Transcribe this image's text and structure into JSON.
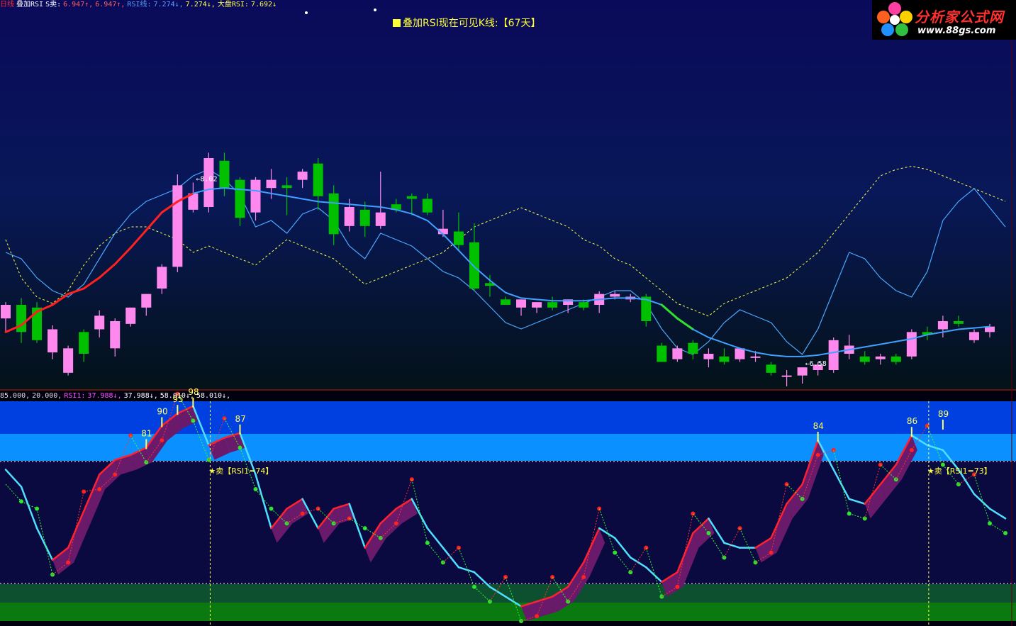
{
  "header": {
    "period": "日线",
    "indicator": "叠加RSI",
    "items": [
      {
        "label": "S卖:",
        "color": "#ffffff"
      },
      {
        "label": "6.947↑,",
        "color": "#ff6060"
      },
      {
        "label": "6.947↑,",
        "color": "#ff6060"
      },
      {
        "label": "RSI线:",
        "color": "#5aa0ff"
      },
      {
        "label": "7.274↓,",
        "color": "#5aa0ff"
      },
      {
        "label": "7.274↓,",
        "color": "#ffff55"
      },
      {
        "label": "大盘RSI:",
        "color": "#ffff55"
      },
      {
        "label": "7.692↓",
        "color": "#ffff55"
      }
    ]
  },
  "visible_bars_label": "叠加RSI现在可见K线:【67天】",
  "logo": {
    "title": "分析家公式网",
    "url": "www.88gs.com"
  },
  "sub_header": {
    "items": [
      {
        "label": "85.000,",
        "color": "#dddddd"
      },
      {
        "label": "20.000,",
        "color": "#dddddd"
      },
      {
        "label": "RSI1:",
        "color": "#ff50ff"
      },
      {
        "label": "37.988↓,",
        "color": "#ff50ff"
      },
      {
        "label": "37.988↓,",
        "color": "#ffffff"
      },
      {
        "label": "58.010↓,",
        "color": "#ffffff"
      },
      {
        "label": "58.010↓,",
        "color": "#ffffff"
      }
    ]
  },
  "colors": {
    "up_candle": "#ff88ee",
    "down_candle": "#00c000",
    "ma_line": "#3fa0ff",
    "ma_up": "#ff2020",
    "ma_down": "#30e030",
    "rsi_line": "#4aa8ff",
    "market_rsi": "#ffff44",
    "sub_rsi": "#50e0ff",
    "sub_shadow": "#6a1a6a"
  },
  "chart_data": [
    {
      "type": "candlestick",
      "title": "",
      "annotations": [
        {
          "label": "←8.02",
          "bar": 12
        },
        {
          "label": "←6.58",
          "bar": 51
        }
      ],
      "ohlc": [
        [
          6.8,
          6.92,
          6.7,
          6.9
        ],
        [
          6.9,
          6.95,
          6.62,
          6.7
        ],
        [
          6.88,
          6.92,
          6.62,
          6.64
        ],
        [
          6.55,
          6.75,
          6.5,
          6.72
        ],
        [
          6.4,
          6.6,
          6.38,
          6.58
        ],
        [
          6.7,
          6.72,
          6.48,
          6.54
        ],
        [
          6.72,
          6.86,
          6.66,
          6.82
        ],
        [
          6.58,
          6.8,
          6.52,
          6.78
        ],
        [
          6.76,
          6.88,
          6.74,
          6.88
        ],
        [
          6.88,
          6.98,
          6.82,
          6.98
        ],
        [
          7.02,
          7.2,
          6.98,
          7.18
        ],
        [
          7.18,
          7.86,
          7.14,
          7.78
        ],
        [
          7.6,
          7.8,
          7.58,
          7.72
        ],
        [
          7.62,
          8.02,
          7.58,
          7.98
        ],
        [
          7.96,
          8.02,
          7.7,
          7.76
        ],
        [
          7.82,
          7.84,
          7.48,
          7.54
        ],
        [
          7.58,
          7.84,
          7.52,
          7.82
        ],
        [
          7.76,
          7.9,
          7.68,
          7.82
        ],
        [
          7.78,
          7.84,
          7.56,
          7.76
        ],
        [
          7.82,
          7.9,
          7.76,
          7.88
        ],
        [
          7.94,
          7.98,
          7.6,
          7.7
        ],
        [
          7.72,
          7.78,
          7.34,
          7.42
        ],
        [
          7.48,
          7.68,
          7.44,
          7.62
        ],
        [
          7.6,
          7.66,
          7.4,
          7.48
        ],
        [
          7.48,
          7.88,
          7.46,
          7.58
        ],
        [
          7.64,
          7.68,
          7.58,
          7.6
        ],
        [
          7.7,
          7.72,
          7.56,
          7.68
        ],
        [
          7.68,
          7.72,
          7.56,
          7.58
        ],
        [
          7.42,
          7.6,
          7.4,
          7.46
        ],
        [
          7.44,
          7.58,
          7.3,
          7.34
        ],
        [
          7.36,
          7.5,
          7.0,
          7.02
        ],
        [
          7.06,
          7.12,
          6.96,
          7.04
        ],
        [
          6.94,
          6.96,
          6.9,
          6.9
        ],
        [
          6.88,
          6.94,
          6.82,
          6.94
        ],
        [
          6.88,
          6.92,
          6.84,
          6.92
        ],
        [
          6.92,
          6.96,
          6.86,
          6.88
        ],
        [
          6.9,
          6.94,
          6.84,
          6.94
        ],
        [
          6.92,
          6.94,
          6.86,
          6.88
        ],
        [
          6.9,
          7.0,
          6.84,
          6.98
        ],
        [
          6.96,
          7.0,
          6.94,
          6.98
        ],
        [
          6.94,
          6.98,
          6.92,
          6.96
        ],
        [
          6.96,
          6.98,
          6.74,
          6.78
        ],
        [
          6.6,
          6.62,
          6.48,
          6.48
        ],
        [
          6.5,
          6.6,
          6.48,
          6.58
        ],
        [
          6.62,
          6.64,
          6.5,
          6.54
        ],
        [
          6.5,
          6.58,
          6.44,
          6.54
        ],
        [
          6.52,
          6.58,
          6.46,
          6.48
        ],
        [
          6.5,
          6.58,
          6.48,
          6.58
        ],
        [
          6.52,
          6.56,
          6.48,
          6.52
        ],
        [
          6.46,
          6.48,
          6.38,
          6.4
        ],
        [
          6.38,
          6.42,
          6.3,
          6.38
        ],
        [
          6.38,
          6.44,
          6.32,
          6.44
        ],
        [
          6.42,
          6.48,
          6.38,
          6.46
        ],
        [
          6.42,
          6.66,
          6.4,
          6.64
        ],
        [
          6.54,
          6.68,
          6.5,
          6.6
        ],
        [
          6.52,
          6.56,
          6.46,
          6.48
        ],
        [
          6.5,
          6.54,
          6.46,
          6.52
        ],
        [
          6.52,
          6.54,
          6.46,
          6.48
        ],
        [
          6.52,
          6.72,
          6.5,
          6.7
        ],
        [
          6.7,
          6.74,
          6.64,
          6.68
        ],
        [
          6.72,
          6.82,
          6.66,
          6.78
        ],
        [
          6.78,
          6.82,
          6.74,
          6.76
        ],
        [
          6.64,
          6.72,
          6.62,
          6.7
        ],
        [
          6.7,
          6.76,
          6.66,
          6.74
        ]
      ],
      "ma": [
        6.7,
        6.75,
        6.85,
        6.9,
        6.98,
        7.02,
        7.1,
        7.2,
        7.32,
        7.45,
        7.58,
        7.66,
        7.72,
        7.75,
        7.76,
        7.75,
        7.74,
        7.72,
        7.7,
        7.68,
        7.66,
        7.65,
        7.64,
        7.63,
        7.62,
        7.6,
        7.57,
        7.52,
        7.42,
        7.3,
        7.18,
        7.08,
        6.99,
        6.95,
        6.94,
        6.93,
        6.93,
        6.93,
        6.94,
        6.95,
        6.95,
        6.94,
        6.9,
        6.8,
        6.72,
        6.66,
        6.62,
        6.58,
        6.55,
        6.53,
        6.52,
        6.52,
        6.53,
        6.55,
        6.57,
        6.59,
        6.61,
        6.63,
        6.65,
        6.68,
        6.7,
        6.72,
        6.73,
        6.74
      ],
      "rsi": [
        72,
        70,
        64,
        60,
        58,
        62,
        70,
        78,
        84,
        88,
        90,
        92,
        96,
        98,
        95,
        90,
        80,
        82,
        78,
        84,
        86,
        82,
        74,
        70,
        78,
        76,
        74,
        70,
        66,
        64,
        60,
        55,
        50,
        48,
        50,
        52,
        54,
        56,
        58,
        60,
        60,
        56,
        48,
        42,
        40,
        44,
        50,
        54,
        52,
        50,
        44,
        40,
        48,
        60,
        72,
        70,
        64,
        60,
        58,
        66,
        82,
        88,
        92,
        86,
        80
      ],
      "market_rsi": [
        76,
        64,
        58,
        56,
        60,
        68,
        74,
        78,
        80,
        80,
        78,
        76,
        72,
        74,
        72,
        70,
        68,
        72,
        76,
        74,
        72,
        70,
        66,
        62,
        64,
        66,
        68,
        70,
        72,
        76,
        80,
        82,
        84,
        86,
        84,
        82,
        80,
        76,
        74,
        70,
        68,
        64,
        60,
        56,
        54,
        52,
        56,
        58,
        60,
        62,
        64,
        68,
        72,
        78,
        84,
        90,
        96,
        98,
        99,
        98,
        96,
        94,
        92,
        90,
        88
      ]
    },
    {
      "type": "line",
      "title": "",
      "ylim": [
        10,
        100
      ],
      "reference_lines": [
        85,
        20
      ],
      "series": [
        {
          "name": "RSI1",
          "values": [
            72,
            65,
            48,
            35,
            40,
            55,
            70,
            76,
            78,
            81,
            90,
            95,
            98,
            82,
            85,
            87,
            70,
            48,
            56,
            60,
            48,
            56,
            58,
            40,
            50,
            56,
            60,
            48,
            40,
            32,
            30,
            24,
            20,
            16,
            18,
            20,
            24,
            34,
            48,
            44,
            36,
            32,
            26,
            30,
            46,
            52,
            42,
            40,
            40,
            44,
            58,
            66,
            84,
            72,
            60,
            58,
            66,
            74,
            86,
            82,
            80,
            72,
            62,
            56,
            52
          ]
        }
      ],
      "markers": [
        {
          "label": "81",
          "bar": 9
        },
        {
          "label": "90",
          "bar": 10
        },
        {
          "label": "95",
          "bar": 11
        },
        {
          "label": "98",
          "bar": 12
        },
        {
          "label": "87",
          "bar": 15
        },
        {
          "label": "84",
          "bar": 52
        },
        {
          "label": "86",
          "bar": 58
        },
        {
          "label": "89",
          "bar": 60
        }
      ],
      "signals": [
        {
          "label": "★卖【RSI1=74】",
          "bar": 13
        },
        {
          "label": "★卖【RSI1=73】",
          "bar": 59
        }
      ]
    }
  ]
}
